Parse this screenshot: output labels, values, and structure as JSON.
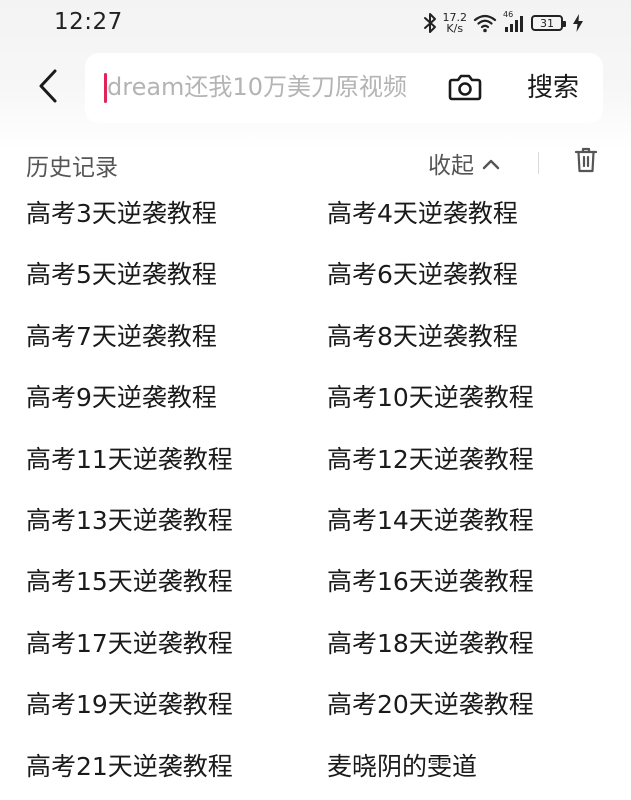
{
  "status_bar": {
    "time": "12:27",
    "net_speed_value": "17.2",
    "net_speed_unit": "K/s",
    "signal_label": "46",
    "battery_level": "31",
    "icons": [
      "bluetooth-icon",
      "wifi-icon",
      "cellular-signal-icon",
      "battery-icon",
      "charging-bolt-icon"
    ]
  },
  "search": {
    "placeholder": "dream还我10万美刀原视频",
    "button_label": "搜索",
    "icons": [
      "back-arrow-icon",
      "camera-icon"
    ]
  },
  "history": {
    "title": "历史记录",
    "collapse_label": "收起",
    "icons": [
      "chevron-up-icon",
      "trash-icon"
    ],
    "items": [
      "高考3天逆袭教程",
      "高考4天逆袭教程",
      "高考5天逆袭教程",
      "高考6天逆袭教程",
      "高考7天逆袭教程",
      "高考8天逆袭教程",
      "高考9天逆袭教程",
      "高考10天逆袭教程",
      "高考11天逆袭教程",
      "高考12天逆袭教程",
      "高考13天逆袭教程",
      "高考14天逆袭教程",
      "高考15天逆袭教程",
      "高考16天逆袭教程",
      "高考17天逆袭教程",
      "高考18天逆袭教程",
      "高考19天逆袭教程",
      "高考20天逆袭教程",
      "高考21天逆袭教程",
      "麦晓阴的雯道"
    ]
  },
  "colors": {
    "cursor": "#e0245a",
    "text": "#1a1a1a",
    "secondary_text": "#555555",
    "placeholder": "#b4b4b4",
    "top_background": "#f3f3f3"
  }
}
